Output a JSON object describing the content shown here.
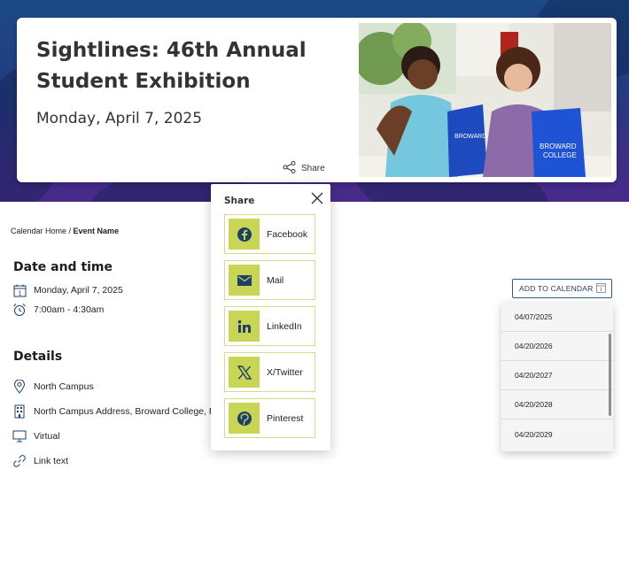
{
  "hero": {
    "title": "Sightlines: 46th Annual Student Exhibition",
    "date": "Monday, April 7, 2025",
    "share_label": "Share",
    "photo_bag_text": "BROWARD COLLEGE"
  },
  "breadcrumb": {
    "home": "Calendar Home",
    "separator": " / ",
    "current": "Event Name"
  },
  "date_time": {
    "heading": "Date and time",
    "date": "Monday, April 7, 2025",
    "time": "7:00am - 4:30am"
  },
  "details": {
    "heading": "Details",
    "campus": "North Campus",
    "address": "North Campus Address, Broward College, F",
    "mode": "Virtual",
    "link": "Link text"
  },
  "share_popup": {
    "title": "Share",
    "options": [
      {
        "label": "Facebook",
        "icon": "facebook-icon"
      },
      {
        "label": "Mail",
        "icon": "mail-icon"
      },
      {
        "label": "LinkedIn",
        "icon": "linkedin-icon"
      },
      {
        "label": "X/Twitter",
        "icon": "x-twitter-icon"
      },
      {
        "label": "Pinterest",
        "icon": "pinterest-icon"
      }
    ]
  },
  "calendar": {
    "button_label": "ADD TO CALENDAR",
    "dates": [
      "04/07/2025",
      "04/20/2026",
      "04/20/2027",
      "04/20/2028",
      "04/20/2029"
    ]
  },
  "colors": {
    "accent": "#c9d655",
    "icon_blue": "#1f3f6b",
    "hero_gradient_top": "#1b4a86",
    "hero_gradient_bottom": "#4a2a8a"
  }
}
